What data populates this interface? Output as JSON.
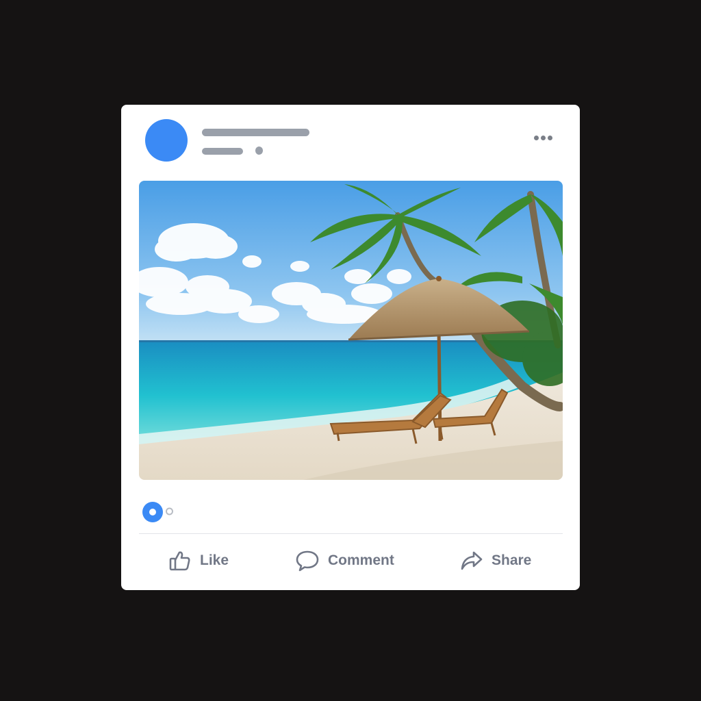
{
  "post": {
    "image_alt": "Tropical beach with palm trees, thatched umbrella and two wooden lounge chairs",
    "actions": {
      "like_label": "Like",
      "comment_label": "Comment",
      "share_label": "Share"
    }
  },
  "colors": {
    "background": "#151313",
    "card": "#ffffff",
    "accent": "#3b8af5",
    "placeholder": "#9aa0aa",
    "action_text": "#717786"
  },
  "icons": {
    "more": "more-horizontal-icon",
    "like": "thumbs-up-icon",
    "comment": "speech-bubble-icon",
    "share": "share-arrow-icon"
  }
}
